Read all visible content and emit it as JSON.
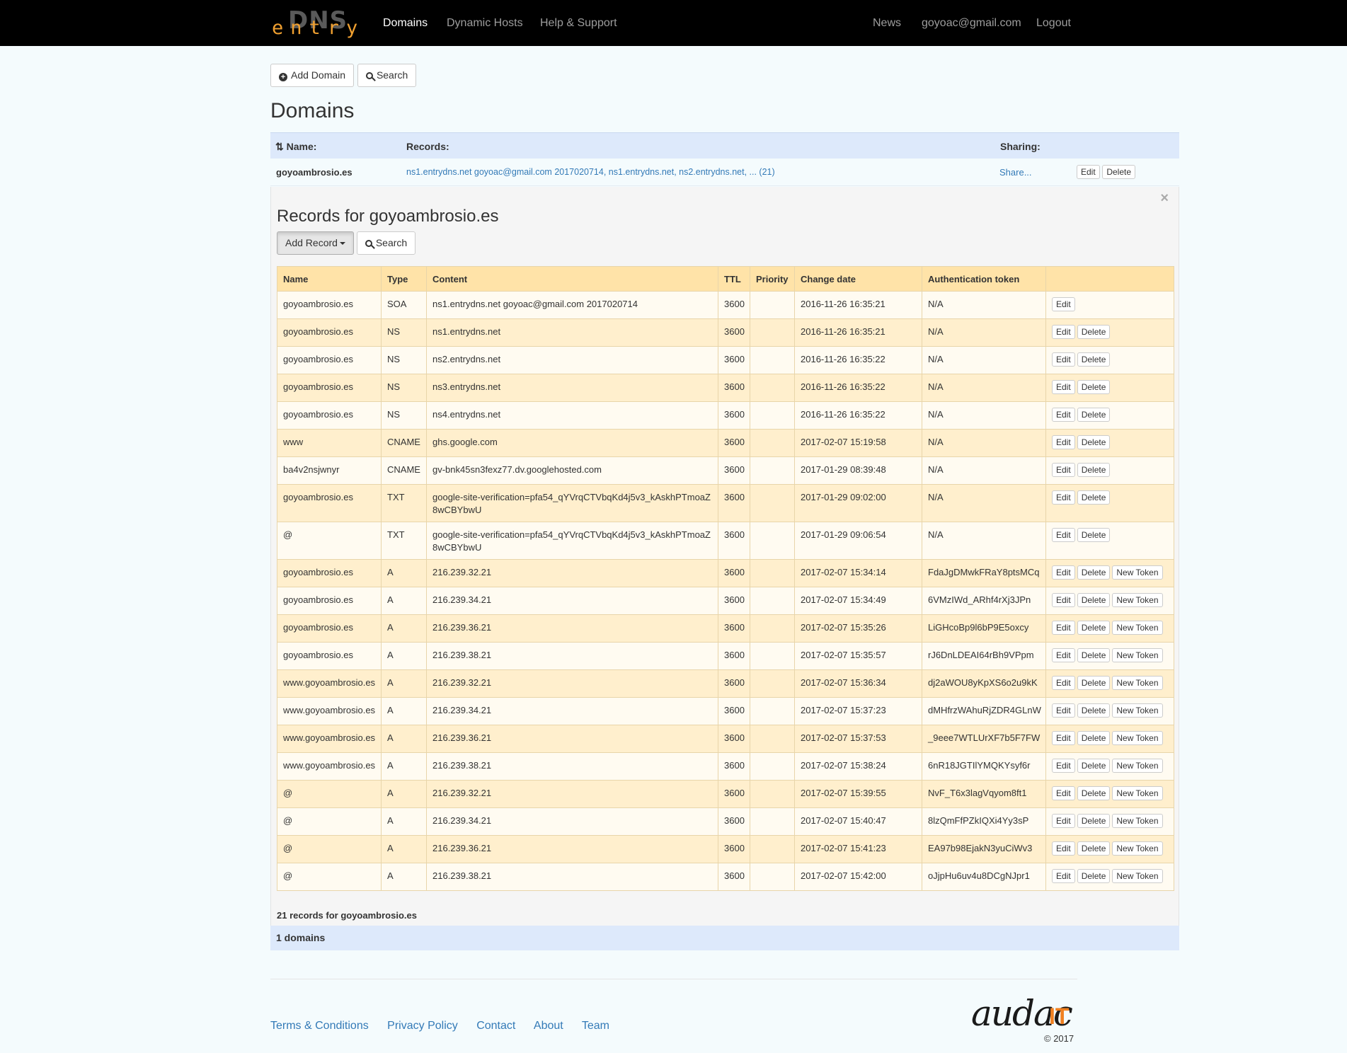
{
  "nav": {
    "logo_dns": "DNS",
    "logo_entry": "entry",
    "links": [
      "Domains",
      "Dynamic Hosts",
      "Help & Support"
    ],
    "right": [
      "News",
      "goyoac@gmail.com",
      "Logout"
    ]
  },
  "toolbar": {
    "add_domain": "Add Domain",
    "search": "Search"
  },
  "page_title": "Domains",
  "domains_table": {
    "headers": {
      "name": "Name:",
      "records": "Records:",
      "sharing": "Sharing:"
    },
    "sort_icon": "⇅",
    "row": {
      "name": "goyoambrosio.es",
      "records": "ns1.entrydns.net goyoac@gmail.com 2017020714, ns1.entrydns.net, ns2.entrydns.net, ... (21)",
      "sharing": "Share...",
      "edit": "Edit",
      "delete": "Delete"
    }
  },
  "records_panel": {
    "close": "×",
    "title": "Records for goyoambrosio.es",
    "add_record": "Add Record",
    "search": "Search",
    "headers": [
      "Name",
      "Type",
      "Content",
      "TTL",
      "Priority",
      "Change date",
      "Authentication token",
      ""
    ],
    "rows": [
      {
        "name": "goyoambrosio.es",
        "type": "SOA",
        "content": "ns1.entrydns.net goyoac@gmail.com 2017020714",
        "ttl": "3600",
        "priority": "",
        "date": "2016-11-26 16:35:21",
        "token": "N/A",
        "edit": "Edit"
      },
      {
        "name": "goyoambrosio.es",
        "type": "NS",
        "content": "ns1.entrydns.net",
        "ttl": "3600",
        "priority": "",
        "date": "2016-11-26 16:35:21",
        "token": "N/A",
        "edit": "Edit",
        "delete": "Delete"
      },
      {
        "name": "goyoambrosio.es",
        "type": "NS",
        "content": "ns2.entrydns.net",
        "ttl": "3600",
        "priority": "",
        "date": "2016-11-26 16:35:22",
        "token": "N/A",
        "edit": "Edit",
        "delete": "Delete"
      },
      {
        "name": "goyoambrosio.es",
        "type": "NS",
        "content": "ns3.entrydns.net",
        "ttl": "3600",
        "priority": "",
        "date": "2016-11-26 16:35:22",
        "token": "N/A",
        "edit": "Edit",
        "delete": "Delete"
      },
      {
        "name": "goyoambrosio.es",
        "type": "NS",
        "content": "ns4.entrydns.net",
        "ttl": "3600",
        "priority": "",
        "date": "2016-11-26 16:35:22",
        "token": "N/A",
        "edit": "Edit",
        "delete": "Delete"
      },
      {
        "name": "www",
        "type": "CNAME",
        "content": "ghs.google.com",
        "ttl": "3600",
        "priority": "",
        "date": "2017-02-07 15:19:58",
        "token": "N/A",
        "edit": "Edit",
        "delete": "Delete"
      },
      {
        "name": "ba4v2nsjwnyr",
        "type": "CNAME",
        "content": "gv-bnk45sn3fexz77.dv.googlehosted.com",
        "ttl": "3600",
        "priority": "",
        "date": "2017-01-29 08:39:48",
        "token": "N/A",
        "edit": "Edit",
        "delete": "Delete"
      },
      {
        "name": "goyoambrosio.es",
        "type": "TXT",
        "content": "google-site-verification=pfa54_qYVrqCTVbqKd4j5v3_kAskhPTmoaZ8wCBYbwU",
        "ttl": "3600",
        "priority": "",
        "date": "2017-01-29 09:02:00",
        "token": "N/A",
        "edit": "Edit",
        "delete": "Delete"
      },
      {
        "name": "@",
        "type": "TXT",
        "content": "google-site-verification=pfa54_qYVrqCTVbqKd4j5v3_kAskhPTmoaZ8wCBYbwU",
        "ttl": "3600",
        "priority": "",
        "date": "2017-01-29 09:06:54",
        "token": "N/A",
        "edit": "Edit",
        "delete": "Delete"
      },
      {
        "name": "goyoambrosio.es",
        "type": "A",
        "content": "216.239.32.21",
        "ttl": "3600",
        "priority": "",
        "date": "2017-02-07 15:34:14",
        "token": "FdaJgDMwkFRaY8ptsMCq",
        "edit": "Edit",
        "delete": "Delete",
        "new_token": "New Token"
      },
      {
        "name": "goyoambrosio.es",
        "type": "A",
        "content": "216.239.34.21",
        "ttl": "3600",
        "priority": "",
        "date": "2017-02-07 15:34:49",
        "token": "6VMzIWd_ARhf4rXj3JPn",
        "edit": "Edit",
        "delete": "Delete",
        "new_token": "New Token"
      },
      {
        "name": "goyoambrosio.es",
        "type": "A",
        "content": "216.239.36.21",
        "ttl": "3600",
        "priority": "",
        "date": "2017-02-07 15:35:26",
        "token": "LiGHcoBp9l6bP9E5oxcy",
        "edit": "Edit",
        "delete": "Delete",
        "new_token": "New Token"
      },
      {
        "name": "goyoambrosio.es",
        "type": "A",
        "content": "216.239.38.21",
        "ttl": "3600",
        "priority": "",
        "date": "2017-02-07 15:35:57",
        "token": "rJ6DnLDEAI64rBh9VPpm",
        "edit": "Edit",
        "delete": "Delete",
        "new_token": "New Token"
      },
      {
        "name": "www.goyoambrosio.es",
        "type": "A",
        "content": "216.239.32.21",
        "ttl": "3600",
        "priority": "",
        "date": "2017-02-07 15:36:34",
        "token": "dj2aWOU8yKpXS6o2u9kK",
        "edit": "Edit",
        "delete": "Delete",
        "new_token": "New Token"
      },
      {
        "name": "www.goyoambrosio.es",
        "type": "A",
        "content": "216.239.34.21",
        "ttl": "3600",
        "priority": "",
        "date": "2017-02-07 15:37:23",
        "token": "dMHfrzWAhuRjZDR4GLnW",
        "edit": "Edit",
        "delete": "Delete",
        "new_token": "New Token"
      },
      {
        "name": "www.goyoambrosio.es",
        "type": "A",
        "content": "216.239.36.21",
        "ttl": "3600",
        "priority": "",
        "date": "2017-02-07 15:37:53",
        "token": "_9eee7WTLUrXF7b5F7FW",
        "edit": "Edit",
        "delete": "Delete",
        "new_token": "New Token"
      },
      {
        "name": "www.goyoambrosio.es",
        "type": "A",
        "content": "216.239.38.21",
        "ttl": "3600",
        "priority": "",
        "date": "2017-02-07 15:38:24",
        "token": "6nR18JGTIlYMQKYsyf6r",
        "edit": "Edit",
        "delete": "Delete",
        "new_token": "New Token"
      },
      {
        "name": "@",
        "type": "A",
        "content": "216.239.32.21",
        "ttl": "3600",
        "priority": "",
        "date": "2017-02-07 15:39:55",
        "token": "NvF_T6x3lagVqyom8ft1",
        "edit": "Edit",
        "delete": "Delete",
        "new_token": "New Token"
      },
      {
        "name": "@",
        "type": "A",
        "content": "216.239.34.21",
        "ttl": "3600",
        "priority": "",
        "date": "2017-02-07 15:40:47",
        "token": "8lzQmFfPZkIQXi4Yy3sP",
        "edit": "Edit",
        "delete": "Delete",
        "new_token": "New Token"
      },
      {
        "name": "@",
        "type": "A",
        "content": "216.239.36.21",
        "ttl": "3600",
        "priority": "",
        "date": "2017-02-07 15:41:23",
        "token": "EA97b98EjakN3yuCiWv3",
        "edit": "Edit",
        "delete": "Delete",
        "new_token": "New Token"
      },
      {
        "name": "@",
        "type": "A",
        "content": "216.239.38.21",
        "ttl": "3600",
        "priority": "",
        "date": "2017-02-07 15:42:00",
        "token": "oJjpHu6uv4u8DCgNJpr1",
        "edit": "Edit",
        "delete": "Delete",
        "new_token": "New Token"
      }
    ],
    "count_text": "21 records for goyoambrosio.es"
  },
  "domains_count": "1 domains",
  "footer": {
    "links": [
      "Terms & Conditions",
      "Privacy Policy",
      "Contact",
      "About",
      "Team"
    ],
    "brand_main": "audac",
    "brand_accent": "IT",
    "copyright": "© 2017"
  },
  "colors": {
    "navbar": "#000000",
    "brand_orange": "#f08020",
    "link": "#337ab7",
    "table_header": "#ffe3a8",
    "row_even": "#ffefcd",
    "row_odd": "#fffbf1",
    "domain_header": "#dde9fb"
  }
}
